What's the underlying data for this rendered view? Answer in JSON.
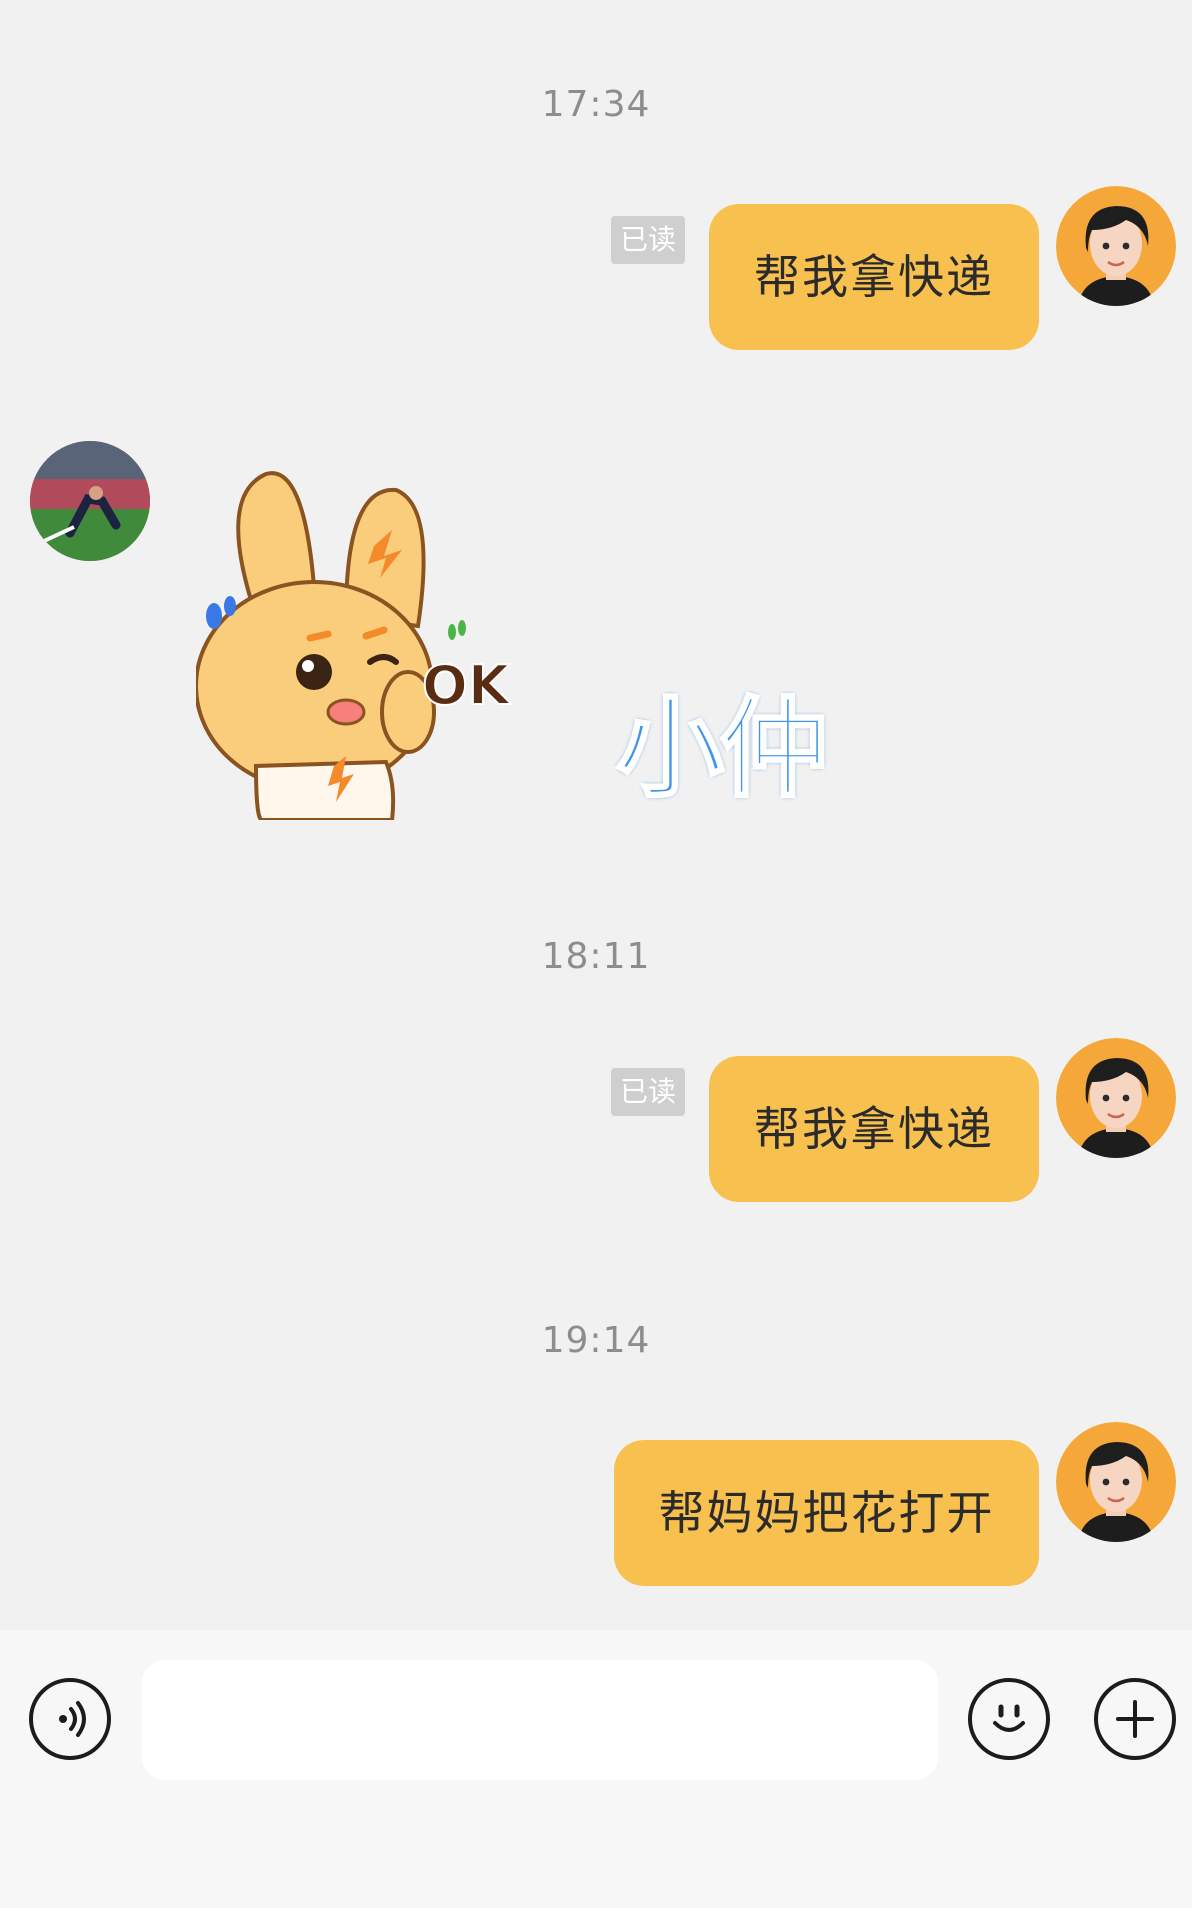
{
  "messages": [
    {
      "type": "time",
      "text": "17:34"
    },
    {
      "type": "outgoing",
      "text": "帮我拿快递",
      "read_label": "已读"
    },
    {
      "type": "incoming-sticker",
      "sticker_text": "OK",
      "caption": "小仲"
    },
    {
      "type": "time",
      "text": "18:11"
    },
    {
      "type": "outgoing",
      "text": "帮我拿快递",
      "read_label": "已读"
    },
    {
      "type": "time",
      "text": "19:14"
    },
    {
      "type": "outgoing",
      "text": "帮妈妈把花打开"
    }
  ],
  "input_bar": {
    "placeholder": "",
    "voice_icon": "voice-icon",
    "emoji_icon": "emoji-icon",
    "add_icon": "plus-icon"
  },
  "colors": {
    "bubble": "#f8c14f",
    "background": "#f1f1f1",
    "read_badge": "#cfcfcf",
    "caption_blue": "#3f95e8"
  }
}
